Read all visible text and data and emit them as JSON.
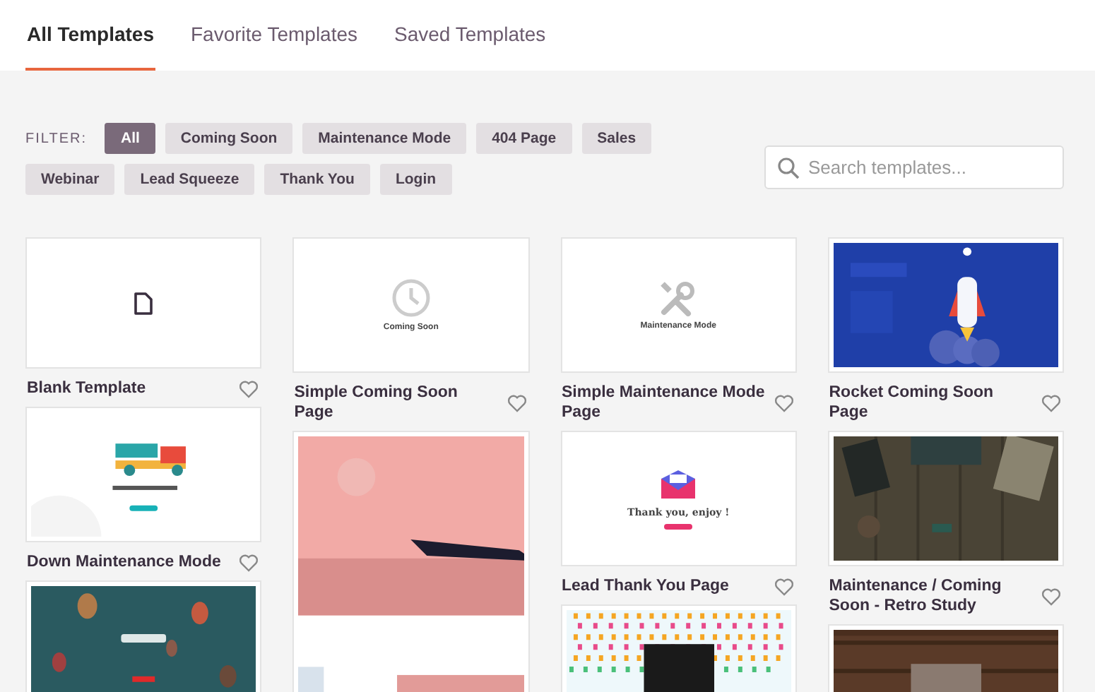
{
  "tabs": [
    {
      "label": "All Templates",
      "selected": true
    },
    {
      "label": "Favorite Templates",
      "selected": false
    },
    {
      "label": "Saved Templates",
      "selected": false
    }
  ],
  "filter": {
    "label": "FILTER:",
    "chips": [
      {
        "label": "All",
        "selected": true
      },
      {
        "label": "Coming Soon",
        "selected": false
      },
      {
        "label": "Maintenance Mode",
        "selected": false
      },
      {
        "label": "404 Page",
        "selected": false
      },
      {
        "label": "Sales",
        "selected": false
      },
      {
        "label": "Webinar",
        "selected": false
      },
      {
        "label": "Lead Squeeze",
        "selected": false
      },
      {
        "label": "Thank You",
        "selected": false
      },
      {
        "label": "Login",
        "selected": false
      }
    ]
  },
  "search": {
    "placeholder": "Search templates..."
  },
  "columns": [
    {
      "cards": [
        {
          "title": "Blank Template",
          "thumb": {
            "kind": "blank"
          }
        },
        {
          "title": "Down Maintenance Mode",
          "thumb": {
            "kind": "picture"
          }
        },
        {
          "thumb": {
            "kind": "picture"
          }
        }
      ]
    },
    {
      "cards": [
        {
          "title": "Simple Coming Soon Page",
          "thumb": {
            "kind": "clock",
            "caption": "Coming Soon"
          }
        },
        {
          "thumb": {
            "kind": "picture"
          }
        }
      ]
    },
    {
      "cards": [
        {
          "title": "Simple Maintenance Mode Page",
          "thumb": {
            "kind": "tools",
            "caption": "Maintenance Mode"
          }
        },
        {
          "title": "Lead Thank You Page",
          "thumb": {
            "kind": "envelope",
            "caption": "Thank you, enjoy !"
          }
        },
        {
          "thumb": {
            "kind": "picture"
          }
        }
      ]
    },
    {
      "cards": [
        {
          "title": "Rocket Coming Soon Page",
          "thumb": {
            "kind": "picture"
          }
        },
        {
          "title": "Maintenance / Coming Soon - Retro Study",
          "thumb": {
            "kind": "picture"
          }
        },
        {
          "thumb": {
            "kind": "picture"
          }
        }
      ]
    }
  ]
}
